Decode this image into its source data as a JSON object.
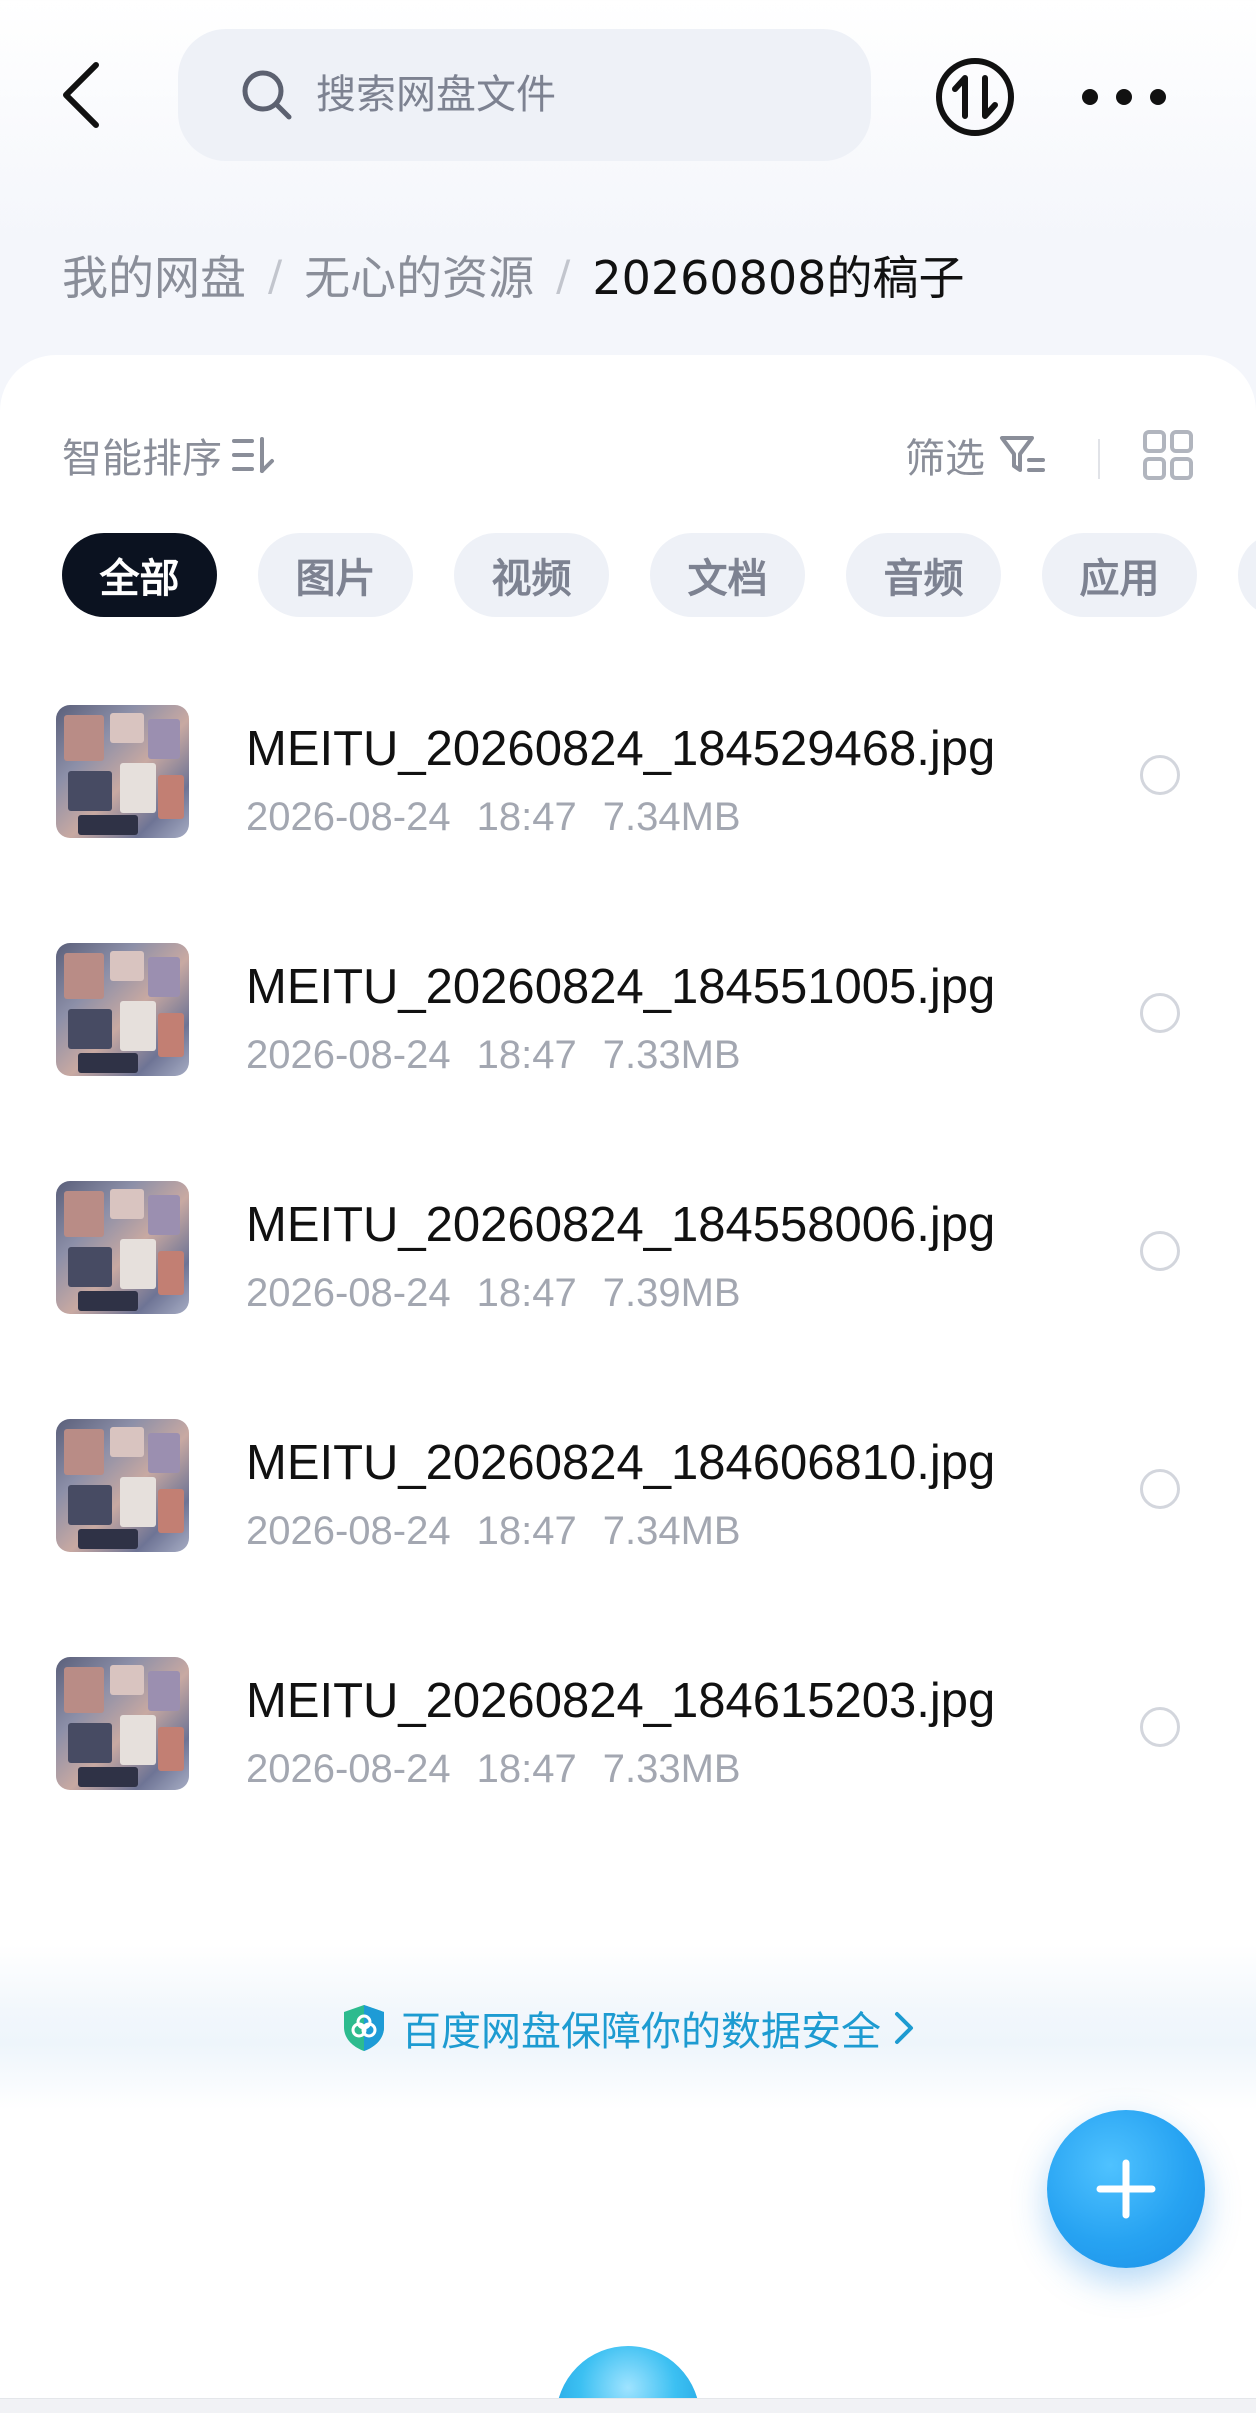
{
  "header": {
    "search_placeholder": "搜索网盘文件"
  },
  "breadcrumb": {
    "items": [
      "我的网盘",
      "无心的资源"
    ],
    "separator": "/",
    "current": "20260808的稿子"
  },
  "toolbar": {
    "sort_label": "智能排序",
    "filter_label": "筛选"
  },
  "chips": [
    {
      "label": "全部",
      "active": true
    },
    {
      "label": "图片",
      "active": false
    },
    {
      "label": "视频",
      "active": false
    },
    {
      "label": "文档",
      "active": false
    },
    {
      "label": "音频",
      "active": false
    },
    {
      "label": "应用",
      "active": false
    }
  ],
  "files": [
    {
      "name": "MEITU_20260824_184529468.jpg",
      "date": "2026-08-24",
      "time": "18:47",
      "size": "7.34MB"
    },
    {
      "name": "MEITU_20260824_184551005.jpg",
      "date": "2026-08-24",
      "time": "18:47",
      "size": "7.33MB"
    },
    {
      "name": "MEITU_20260824_184558006.jpg",
      "date": "2026-08-24",
      "time": "18:47",
      "size": "7.39MB"
    },
    {
      "name": "MEITU_20260824_184606810.jpg",
      "date": "2026-08-24",
      "time": "18:47",
      "size": "7.34MB"
    },
    {
      "name": "MEITU_20260824_184615203.jpg",
      "date": "2026-08-24",
      "time": "18:47",
      "size": "7.33MB"
    }
  ],
  "security_banner": {
    "text": "百度网盘保障你的数据安全"
  },
  "colors": {
    "accent": "#1d9bd1",
    "fab": "#27a3f2",
    "chip_active_bg": "#0b1220",
    "chip_bg": "#eef1f7"
  },
  "icons": {
    "back": "chevron-left-icon",
    "search": "search-icon",
    "transfer": "transfer-icon",
    "more": "more-icon",
    "sort": "sort-icon",
    "filter": "filter-icon",
    "grid": "grid-view-icon",
    "shield": "shield-icon",
    "add": "plus-icon"
  }
}
